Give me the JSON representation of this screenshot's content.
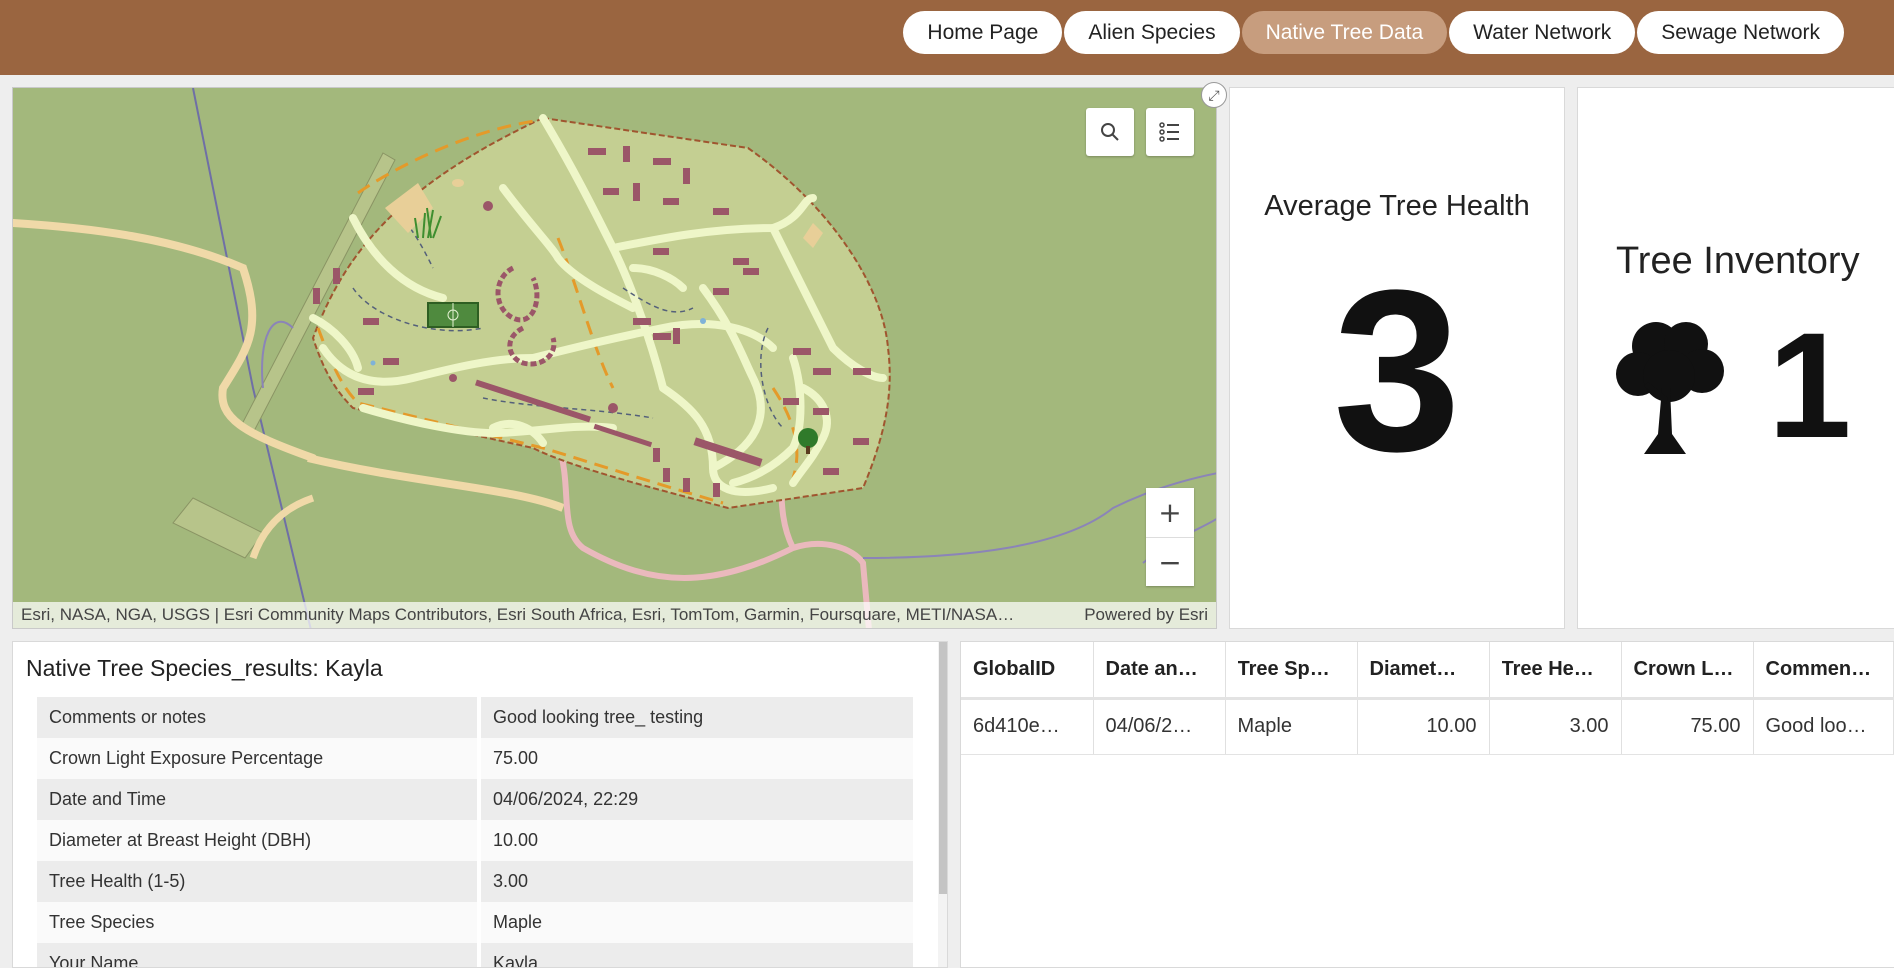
{
  "nav": {
    "items": [
      {
        "label": "Home Page"
      },
      {
        "label": "Alien Species"
      },
      {
        "label": "Native Tree Data",
        "active": true
      },
      {
        "label": "Water Network"
      },
      {
        "label": "Sewage Network"
      }
    ]
  },
  "map": {
    "attribution": "Esri, NASA, NGA, USGS | Esri Community Maps Contributors, Esri South Africa, Esri, TomTom, Garmin, Foursquare, METI/NASA…",
    "powered_by": "Powered by Esri",
    "zoom_in": "+",
    "zoom_out": "−",
    "icons": {
      "search": "search-icon",
      "legend": "legend-list-icon",
      "expand": "expand-icon"
    }
  },
  "indicators": {
    "health": {
      "title": "Average Tree Health",
      "value": "3"
    },
    "inventory": {
      "title": "Tree Inventory",
      "value": "1",
      "icon": "tree-icon"
    }
  },
  "details": {
    "title": "Native Tree Species_results: Kayla",
    "rows": [
      {
        "key": "Comments or notes",
        "value": "Good looking tree_ testing"
      },
      {
        "key": "Crown Light Exposure Percentage",
        "value": "75.00"
      },
      {
        "key": "Date and Time",
        "value": "04/06/2024, 22:29"
      },
      {
        "key": "Diameter at Breast Height (DBH)",
        "value": "10.00"
      },
      {
        "key": "Tree Health (1-5)",
        "value": "3.00"
      },
      {
        "key": "Tree Species",
        "value": "Maple"
      },
      {
        "key": "Your Name",
        "value": "Kayla"
      }
    ]
  },
  "table": {
    "columns": [
      "GlobalID",
      "Date an…",
      "Tree Sp…",
      "Diamet…",
      "Tree He…",
      "Crown L…",
      "Commen…"
    ],
    "rows": [
      [
        "6d410e…",
        "04/06/2…",
        "Maple",
        "10.00",
        "3.00",
        "75.00",
        "Good loo…"
      ]
    ]
  },
  "colors": {
    "header": "#9a6540",
    "active_tab": "#c79d7e",
    "map_base": "#a3b87c",
    "campus": "#c4cf92"
  }
}
